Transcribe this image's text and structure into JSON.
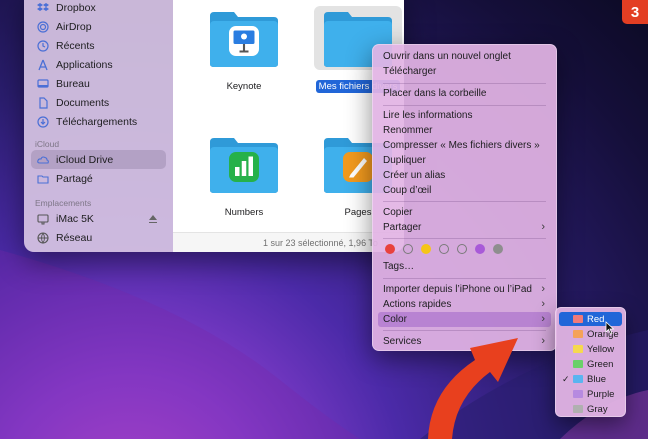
{
  "sidebar": {
    "favorites": [
      {
        "label": "Dropbox",
        "icon": "dropbox-icon"
      },
      {
        "label": "AirDrop",
        "icon": "airdrop-icon"
      },
      {
        "label": "Récents",
        "icon": "clock-icon"
      },
      {
        "label": "Applications",
        "icon": "applications-icon"
      },
      {
        "label": "Bureau",
        "icon": "desktop-icon"
      },
      {
        "label": "Documents",
        "icon": "document-icon"
      },
      {
        "label": "Téléchargements",
        "icon": "download-icon"
      }
    ],
    "icloud_heading": "iCloud",
    "icloud": [
      {
        "label": "iCloud Drive",
        "icon": "cloud-icon"
      },
      {
        "label": "Partagé",
        "icon": "shared-folder-icon"
      }
    ],
    "locations_heading": "Emplacements",
    "locations": [
      {
        "label": "iMac 5K",
        "icon": "imac-icon"
      },
      {
        "label": "Réseau",
        "icon": "network-icon"
      }
    ]
  },
  "files": [
    {
      "label": "Keynote",
      "app": "keynote"
    },
    {
      "label": "Mes fichiers divers",
      "selected": true
    },
    {
      "label": "",
      "app": ""
    },
    {
      "label": "Numbers",
      "app": "numbers"
    },
    {
      "label": "Pages",
      "app": "pages"
    }
  ],
  "status_bar": "1 sur 23 sélectionné, 1,96 To",
  "context_menu": {
    "items": [
      "Ouvrir dans un nouvel onglet",
      "Télécharger",
      "Placer dans la corbeille",
      "Lire les informations",
      "Renommer",
      "Compresser « Mes fichiers divers »",
      "Dupliquer",
      "Créer un alias",
      "Coup d’œil",
      "Copier",
      "Partager",
      "Tags…",
      "Importer depuis l’iPhone ou l’iPad",
      "Actions rapides",
      "Color",
      "Services"
    ],
    "tag_colors": [
      "#e8423d",
      "hollow",
      "#f5c518",
      "hollow",
      "hollow",
      "#a85ad8",
      "#8e8e8e"
    ]
  },
  "color_submenu": {
    "items": [
      {
        "label": "Red",
        "color": "#f07a7a"
      },
      {
        "label": "Orange",
        "color": "#f4a259"
      },
      {
        "label": "Yellow",
        "color": "#f6d94e"
      },
      {
        "label": "Green",
        "color": "#6ad06a"
      },
      {
        "label": "Blue",
        "color": "#5ab4f0",
        "checked": true
      },
      {
        "label": "Purple",
        "color": "#b68ae0"
      },
      {
        "label": "Gray",
        "color": "#b0b0b0"
      }
    ]
  },
  "badge": "3",
  "colors": {
    "folder": "#3fb0ec",
    "folder_tab": "#2f9ad8",
    "selection": "#2166d8",
    "badge": "#e33e23",
    "arrow": "#e8401e"
  }
}
